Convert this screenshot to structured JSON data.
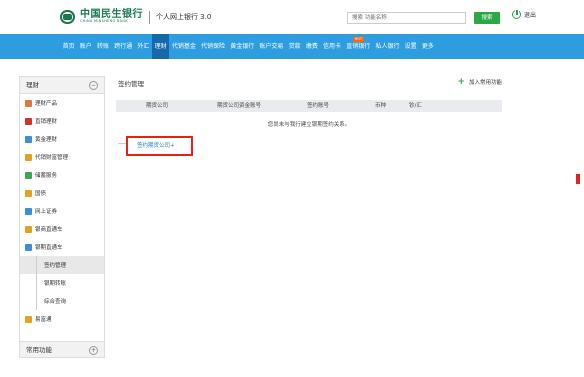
{
  "header": {
    "logo_cn": "中国民生银行",
    "logo_en": "CHINA MINSHENG BANK",
    "title": "个人网上银行 3.0",
    "search_placeholder": "搜索 功能名称",
    "search_button": "搜索",
    "logout": "退出"
  },
  "nav": {
    "items": [
      "首页",
      "账户",
      "转账",
      "跨行通",
      "外汇",
      "理财",
      "代销基金",
      "代销保险",
      "黄金银行",
      "账户交易",
      "贷款",
      "缴费",
      "信用卡",
      "直销银行",
      "私人银行",
      "设置",
      "更多"
    ],
    "active": "理财",
    "hot_badge": "HOT"
  },
  "sidebar": {
    "title": "理财",
    "items": [
      {
        "label": "理财产品",
        "icon": "chart-icon"
      },
      {
        "label": "直销理财",
        "icon": "gift-icon"
      },
      {
        "label": "黄金理财",
        "icon": "bar-chart-icon"
      },
      {
        "label": "代销财富管理",
        "icon": "coins-icon"
      },
      {
        "label": "储蓄服务",
        "icon": "book-icon"
      },
      {
        "label": "国债",
        "icon": "bond-icon"
      },
      {
        "label": "网上证券",
        "icon": "securities-icon"
      },
      {
        "label": "银商直通车",
        "icon": "car-icon"
      },
      {
        "label": "银期直通车",
        "icon": "car-icon"
      }
    ],
    "sub_items": [
      "签约管理",
      "银期转账",
      "综合查询"
    ],
    "active_sub": "签约管理",
    "extra_item": "易富通",
    "footer": "常用功能"
  },
  "main": {
    "title": "签约管理",
    "add_favorite": "加入常用功能",
    "columns": [
      "期货公司",
      "期货公司资金账号",
      "签约账号",
      "币种",
      "钞/汇"
    ],
    "notice": "您尚未与我行建立银期签约关系。",
    "sign_button": "签约期货公司+"
  }
}
